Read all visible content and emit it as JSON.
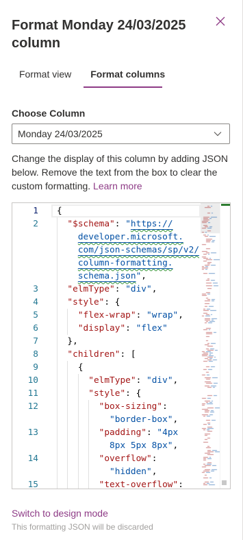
{
  "panel": {
    "title": "Format Monday 24/03/2025 column",
    "close_icon": "close-icon"
  },
  "tabs": [
    {
      "label": "Format view",
      "selected": false
    },
    {
      "label": "Format columns",
      "selected": true
    }
  ],
  "choose_column": {
    "label": "Choose Column",
    "selected_value": "Monday 24/03/2025",
    "icon": "chevron-down-icon"
  },
  "description": {
    "text": "Change the display of this column by adding JSON below. Remove the text from the box to clear the custom formatting.",
    "link": "Learn more"
  },
  "editor": {
    "rows": [
      {
        "num": "1",
        "active": true,
        "tokens": [
          {
            "type": "punct",
            "text": "{"
          }
        ]
      },
      {
        "num": "2",
        "tokens": [
          {
            "type": "indent",
            "text": "  "
          },
          {
            "type": "key",
            "text": "\"$schema\""
          },
          {
            "type": "punct",
            "text": ": "
          },
          {
            "type": "string",
            "text": "\""
          },
          {
            "type": "url",
            "text": "https://"
          }
        ]
      },
      {
        "wrapped": true,
        "tokens": [
          {
            "type": "indent",
            "text": "    "
          },
          {
            "type": "url",
            "text": "developer.microsoft."
          }
        ]
      },
      {
        "wrapped": true,
        "tokens": [
          {
            "type": "indent",
            "text": "    "
          },
          {
            "type": "url",
            "text": "com/json-schemas/sp/v2/"
          }
        ]
      },
      {
        "wrapped": true,
        "tokens": [
          {
            "type": "indent",
            "text": "    "
          },
          {
            "type": "url",
            "text": "column-formatting."
          }
        ]
      },
      {
        "wrapped": true,
        "tokens": [
          {
            "type": "indent",
            "text": "    "
          },
          {
            "type": "url",
            "text": "schema.json"
          },
          {
            "type": "string",
            "text": "\""
          },
          {
            "type": "punct",
            "text": ","
          }
        ]
      },
      {
        "num": "3",
        "tokens": [
          {
            "type": "indent",
            "text": "  "
          },
          {
            "type": "key",
            "text": "\"elmType\""
          },
          {
            "type": "punct",
            "text": ": "
          },
          {
            "type": "string",
            "text": "\"div\""
          },
          {
            "type": "punct",
            "text": ","
          }
        ]
      },
      {
        "num": "4",
        "tokens": [
          {
            "type": "indent",
            "text": "  "
          },
          {
            "type": "key",
            "text": "\"style\""
          },
          {
            "type": "punct",
            "text": ": {"
          }
        ]
      },
      {
        "num": "5",
        "tokens": [
          {
            "type": "indent",
            "text": "    "
          },
          {
            "type": "key",
            "text": "\"flex-wrap\""
          },
          {
            "type": "punct",
            "text": ": "
          },
          {
            "type": "string",
            "text": "\"wrap\""
          },
          {
            "type": "punct",
            "text": ","
          }
        ]
      },
      {
        "num": "6",
        "tokens": [
          {
            "type": "indent",
            "text": "    "
          },
          {
            "type": "key",
            "text": "\"display\""
          },
          {
            "type": "punct",
            "text": ": "
          },
          {
            "type": "string",
            "text": "\"flex\""
          }
        ]
      },
      {
        "num": "7",
        "tokens": [
          {
            "type": "indent",
            "text": "  "
          },
          {
            "type": "punct",
            "text": "},"
          }
        ]
      },
      {
        "num": "8",
        "tokens": [
          {
            "type": "indent",
            "text": "  "
          },
          {
            "type": "key",
            "text": "\"children\""
          },
          {
            "type": "punct",
            "text": ": ["
          }
        ]
      },
      {
        "num": "9",
        "tokens": [
          {
            "type": "indent",
            "text": "    "
          },
          {
            "type": "punct",
            "text": "{"
          }
        ]
      },
      {
        "num": "10",
        "tokens": [
          {
            "type": "indent",
            "text": "      "
          },
          {
            "type": "key",
            "text": "\"elmType\""
          },
          {
            "type": "punct",
            "text": ": "
          },
          {
            "type": "string",
            "text": "\"div\""
          },
          {
            "type": "punct",
            "text": ","
          }
        ]
      },
      {
        "num": "11",
        "tokens": [
          {
            "type": "indent",
            "text": "      "
          },
          {
            "type": "key",
            "text": "\"style\""
          },
          {
            "type": "punct",
            "text": ": {"
          }
        ]
      },
      {
        "num": "12",
        "tokens": [
          {
            "type": "indent",
            "text": "        "
          },
          {
            "type": "key",
            "text": "\"box-sizing\""
          },
          {
            "type": "punct",
            "text": ":"
          }
        ]
      },
      {
        "wrapped": true,
        "tokens": [
          {
            "type": "indent",
            "text": "          "
          },
          {
            "type": "string",
            "text": "\"border-box\""
          },
          {
            "type": "punct",
            "text": ","
          }
        ]
      },
      {
        "num": "13",
        "tokens": [
          {
            "type": "indent",
            "text": "        "
          },
          {
            "type": "key",
            "text": "\"padding\""
          },
          {
            "type": "punct",
            "text": ": "
          },
          {
            "type": "string",
            "text": "\"4px"
          }
        ]
      },
      {
        "wrapped": true,
        "tokens": [
          {
            "type": "indent",
            "text": "          "
          },
          {
            "type": "string",
            "text": "8px 5px 8px\""
          },
          {
            "type": "punct",
            "text": ","
          }
        ]
      },
      {
        "num": "14",
        "tokens": [
          {
            "type": "indent",
            "text": "        "
          },
          {
            "type": "key",
            "text": "\"overflow\""
          },
          {
            "type": "punct",
            "text": ":"
          }
        ]
      },
      {
        "wrapped": true,
        "tokens": [
          {
            "type": "indent",
            "text": "          "
          },
          {
            "type": "string",
            "text": "\"hidden\""
          },
          {
            "type": "punct",
            "text": ","
          }
        ]
      },
      {
        "num": "15",
        "tokens": [
          {
            "type": "indent",
            "text": "        "
          },
          {
            "type": "key",
            "text": "\"text-overflow\""
          },
          {
            "type": "punct",
            "text": ":"
          }
        ]
      }
    ]
  },
  "footer": {
    "switch_link": "Switch to design mode",
    "note": "This formatting JSON will be discarded"
  },
  "colors": {
    "accent": "#8e3b86",
    "text": "#323130",
    "json_key": "#a31515",
    "json_string": "#0451a5",
    "line_number": "#237893",
    "squiggle": "#3c9a3c"
  }
}
